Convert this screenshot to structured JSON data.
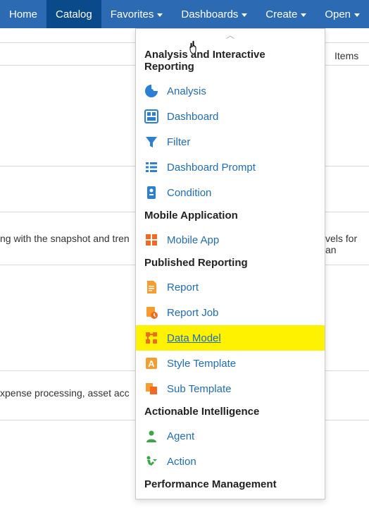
{
  "nav": {
    "home": "Home",
    "catalog": "Catalog",
    "favorites": "Favorites",
    "dashboards": "Dashboards",
    "create": "Create",
    "open": "Open"
  },
  "bg": {
    "items": "Items",
    "snapshot": "ng with the snapshot and tren",
    "levels": "vels for an",
    "expense": "xpense processing, asset acc"
  },
  "menu": {
    "h1": "Analysis and Interactive Reporting",
    "analysis": "Analysis",
    "dashboard": "Dashboard",
    "filter": "Filter",
    "dashboard_prompt": "Dashboard Prompt",
    "condition": "Condition",
    "h2": "Mobile Application",
    "mobile_app": "Mobile App",
    "h3": "Published Reporting",
    "report": "Report",
    "report_job": "Report Job",
    "data_model": "Data Model",
    "style_template": "Style Template",
    "sub_template": "Sub Template",
    "h4": "Actionable Intelligence",
    "agent": "Agent",
    "action": "Action",
    "h5": "Performance Management"
  }
}
